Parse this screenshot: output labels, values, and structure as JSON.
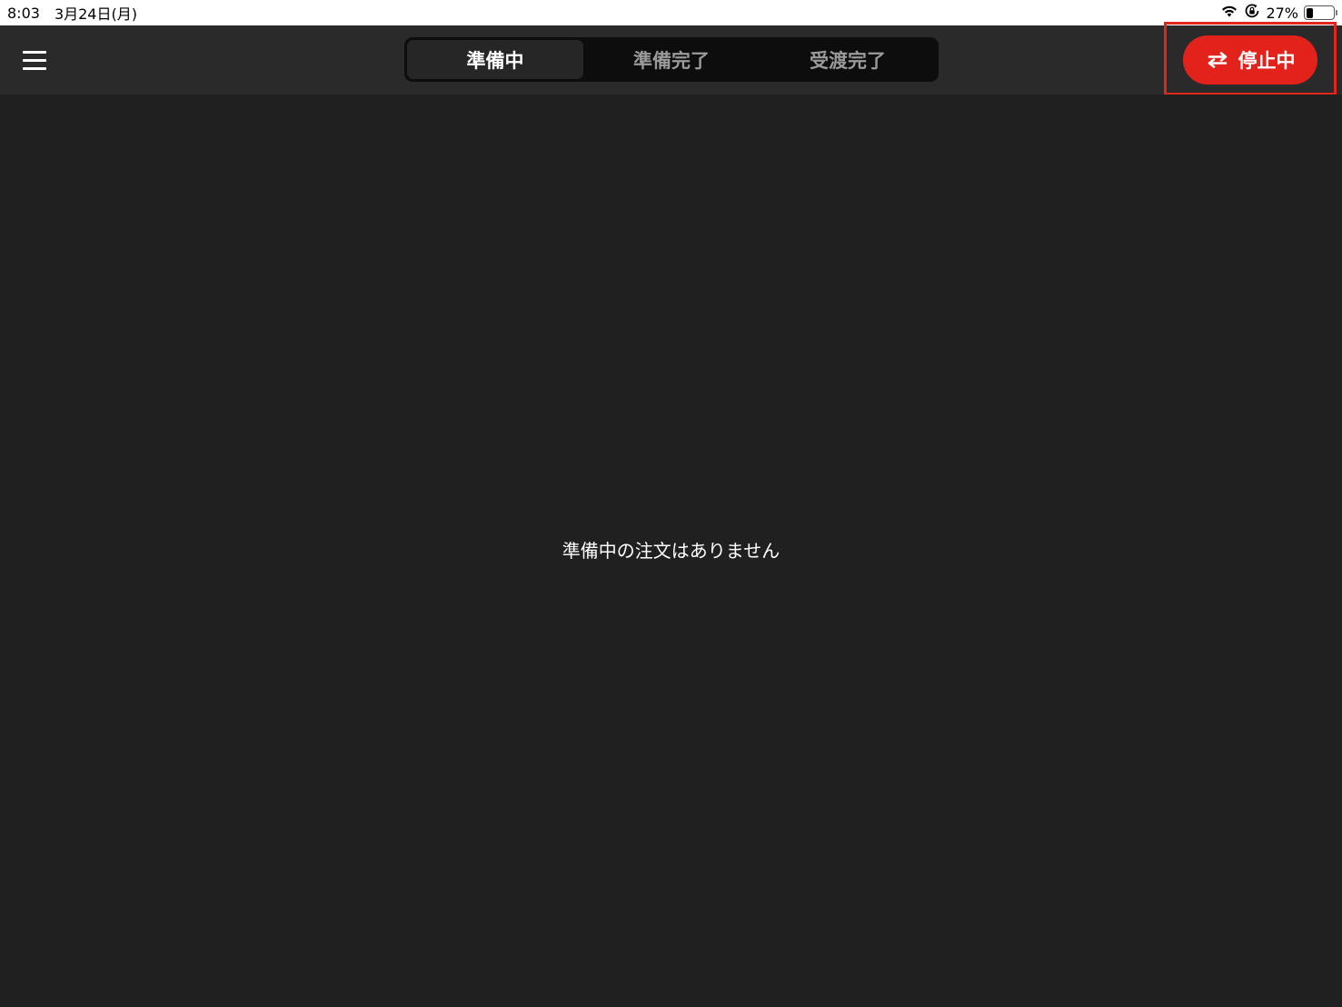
{
  "status_bar": {
    "time": "8:03",
    "date": "3月24日(月)",
    "battery_percent": "27%",
    "battery_level": 0.27,
    "icons": [
      "wifi-icon",
      "screen-lock-icon",
      "battery-icon"
    ]
  },
  "header": {
    "tabs": [
      {
        "label": "準備中",
        "active": true
      },
      {
        "label": "準備完了",
        "active": false
      },
      {
        "label": "受渡完了",
        "active": false
      }
    ],
    "status_button": {
      "label": "停止中",
      "icon": "swap-arrows-icon",
      "color": "#e3221c"
    },
    "menu_icon": "hamburger-menu-icon"
  },
  "main": {
    "empty_message": "準備中の注文はありません"
  },
  "colors": {
    "background": "#202020",
    "header_background": "#2a2a2a",
    "accent_red": "#e3221c",
    "highlight_border": "#e3261b"
  }
}
